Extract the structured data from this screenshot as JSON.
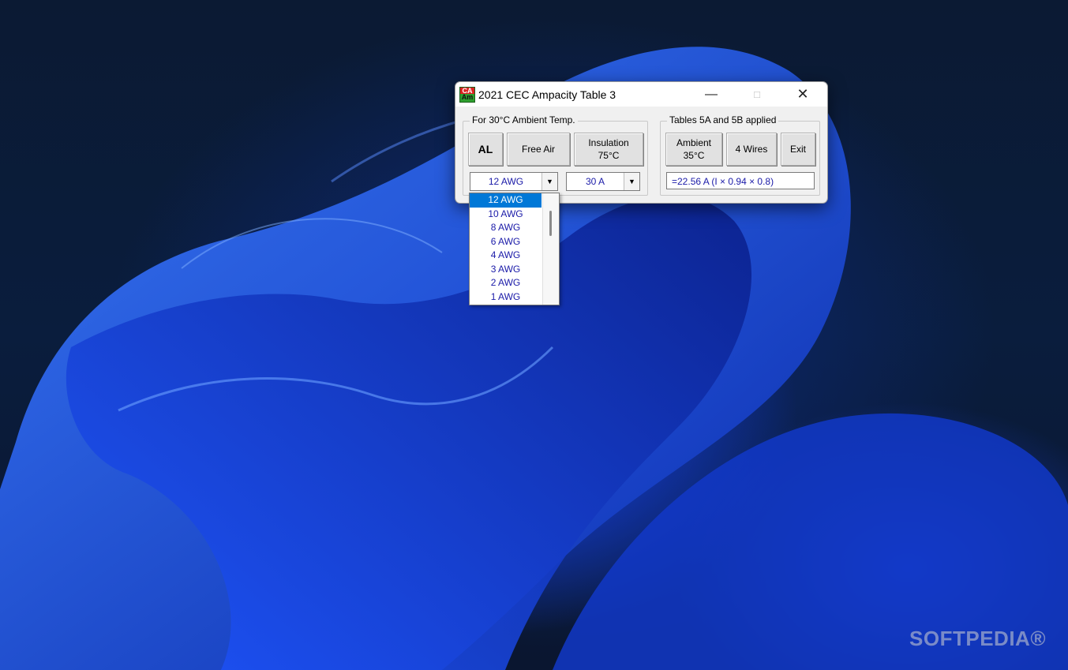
{
  "window": {
    "title": "2021 CEC Ampacity Table 3",
    "icon": "app-icon",
    "icon_letters_top": "CA",
    "icon_letters_bottom": "Am"
  },
  "left_group": {
    "label": "For 30°C Ambient Temp.",
    "buttons": {
      "al": "AL",
      "free_air": "Free Air",
      "insulation": "Insulation\n75°C"
    },
    "wire_combo_value": "12 AWG",
    "amp_combo_value": "30 A"
  },
  "right_group": {
    "label": "Tables 5A and 5B applied",
    "buttons": {
      "ambient": "Ambient\n35°C",
      "wires": "4 Wires",
      "exit": "Exit"
    },
    "result": "=22.56 A  (I × 0.94 × 0.8)"
  },
  "dropdown": {
    "items": [
      "12 AWG",
      "10 AWG",
      "8 AWG",
      "6 AWG",
      "4 AWG",
      "3 AWG",
      "2 AWG",
      "1 AWG"
    ],
    "selected": "12 AWG"
  },
  "watermark": "SOFTPEDIA®"
}
